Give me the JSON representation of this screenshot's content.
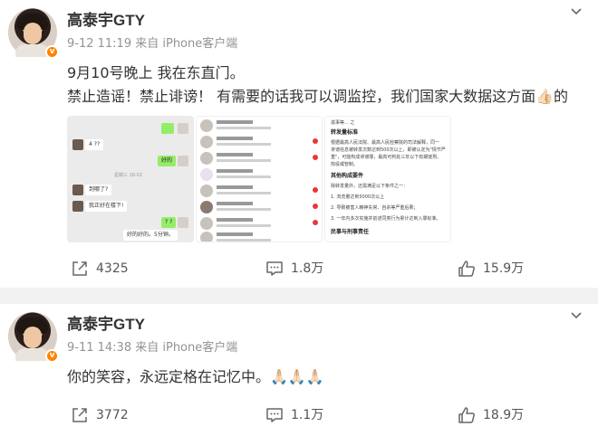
{
  "posts": [
    {
      "author": "高泰宇GTY",
      "meta": "9-12 11:19  来自 iPhone客户端",
      "lines": [
        "9月10号晚上 我在东直门。",
        "禁止造谣！禁止诽谤！ 有需要的话我可以调监控，我们国家大数据这方面👍🏻的"
      ],
      "images": [
        {
          "alt": "chat-screenshot",
          "time": "星期三 16:02",
          "bubbles": [
            "4 ??",
            "好的",
            "到哪了?",
            "我正好在楼下!",
            "? ?",
            "好的好的。5分钟。"
          ]
        },
        {
          "alt": "message-list-screenshot"
        },
        {
          "alt": "legal-text-screenshot",
          "lines": [
            "滋事等... 之",
            "转发量标准",
            "根据最高人民法院、最高人民检察院的司法解释，同一",
            "诽谤信息被转发次数达到500次以上，即被认定为\"情节严",
            "重\"，可能构成诽谤罪，最高可判处三年以下有期徒刑、",
            "拘役或管制。",
            "其他构成要件",
            "除转发量外，还需满足以下条件之一：",
            "1. 浏览量达到5000次以上",
            "2. 导致被害人精神失常、自杀等严重后果；",
            "3. 一年内多次实施并前述同类行为累计达到入罪标准。",
            "民事与刑事责任"
          ]
        }
      ],
      "footer": {
        "reposts": "4325",
        "comments": "1.8万",
        "likes": "15.9万"
      }
    },
    {
      "author": "高泰宇GTY",
      "meta": "9-11 14:38  来自 iPhone客户端",
      "lines": [
        "你的笑容，永远定格在记忆中。🙏🏻🙏🏻🙏🏻"
      ],
      "footer": {
        "reposts": "3772",
        "comments": "1.1万",
        "likes": "18.9万"
      }
    }
  ],
  "icons": {
    "verified_badge": "v-badge-icon",
    "more": "chevron-down-icon",
    "repost": "repost-icon",
    "comment": "comment-icon",
    "like": "thumbs-up-icon"
  },
  "colors": {
    "verified": "#ff8200",
    "meta_text": "#939393",
    "body_text": "#333333",
    "chat_green": "#95ec69",
    "unread_red": "#e4393c"
  }
}
